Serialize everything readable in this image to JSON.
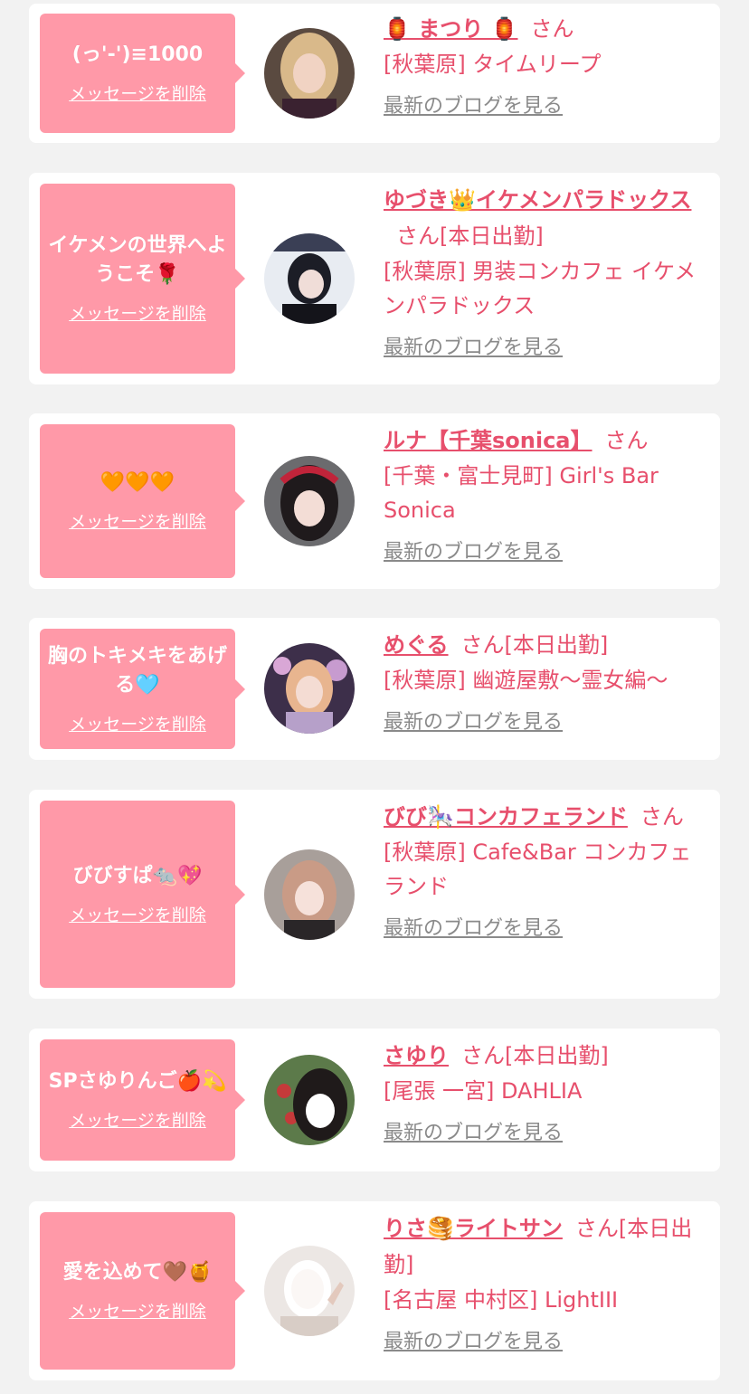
{
  "cards": [
    {
      "message": "(っ'-')≡1000",
      "delete_label": "メッセージを削除",
      "name": "🏮 まつり 🏮",
      "honorific": "さん",
      "status": "",
      "shop": "[秋葉原] タイムリープ",
      "blog_label": "最新のブログを見る"
    },
    {
      "message": "イケメンの世界へようこそ🌹",
      "delete_label": "メッセージを削除",
      "name": "ゆづき👑イケメンパラドックス",
      "honorific": "さん",
      "status": "[本日出勤]",
      "shop": "[秋葉原] 男装コンカフェ イケメンパラドックス",
      "blog_label": "最新のブログを見る"
    },
    {
      "message": "🧡🧡🧡",
      "delete_label": "メッセージを削除",
      "name": "ルナ【千葉sonica】",
      "honorific": "さん",
      "status": "",
      "shop": "[千葉・富士見町] Girl's Bar Sonica",
      "blog_label": "最新のブログを見る"
    },
    {
      "message": "胸のトキメキをあげる🩵",
      "delete_label": "メッセージを削除",
      "name": "めぐる",
      "honorific": "さん",
      "status": "[本日出勤]",
      "shop": "[秋葉原] 幽遊屋敷〜霊女編〜",
      "blog_label": "最新のブログを見る"
    },
    {
      "message": "びびすぱ🐀💖",
      "delete_label": "メッセージを削除",
      "name": "びび🎠コンカフェランド",
      "honorific": "さん",
      "status": "",
      "shop": "[秋葉原] Cafe&Bar コンカフェランド",
      "blog_label": "最新のブログを見る"
    },
    {
      "message": "SPさゆりんご🍎💫",
      "delete_label": "メッセージを削除",
      "name": "さゆり",
      "honorific": "さん",
      "status": "[本日出勤]",
      "shop": "[尾張 一宮] DAHLIA",
      "blog_label": "最新のブログを見る"
    },
    {
      "message": "愛を込めて🤎🍯",
      "delete_label": "メッセージを削除",
      "name": "りさ🥞ライトサン",
      "honorific": "さん",
      "status": "[本日出勤]",
      "shop": "[名古屋 中村区] LightIII",
      "blog_label": "最新のブログを見る"
    }
  ]
}
